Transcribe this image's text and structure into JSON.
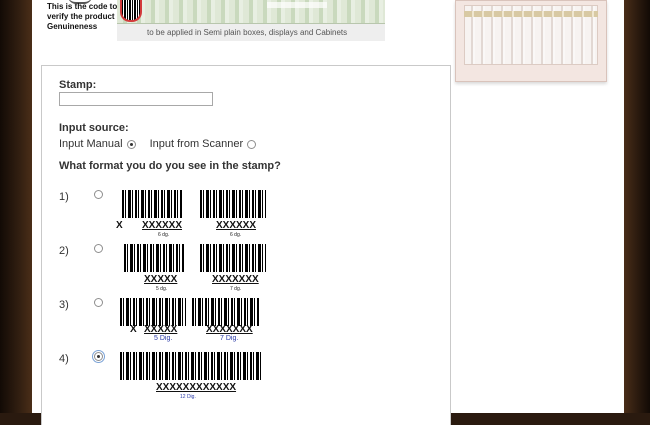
{
  "banner": {
    "code_note": "This is the code to verify the product Genuineness",
    "caption": "to be applied in Semi plain boxes, displays and Cabinets"
  },
  "form": {
    "stamp_label": "Stamp:",
    "stamp_value": "",
    "input_source_label": "Input source:",
    "input_manual_label": "Input Manual",
    "input_scanner_label": "Input from Scanner",
    "input_source_selected": "manual",
    "format_question": "What format you do you see in the stamp?",
    "selected_format": 4,
    "options": [
      {
        "number": "1)",
        "left_prefix": "X",
        "left_code": "XXXXXX",
        "left_digits": "6 dg.",
        "right_code": "XXXXXX",
        "right_digits": "6 dg."
      },
      {
        "number": "2)",
        "left_code": "XXXXX",
        "left_digits": "5 dg.",
        "right_code": "XXXXXXX",
        "right_digits": "7 dg."
      },
      {
        "number": "3)",
        "left_prefix": "X",
        "left_code": "XXXXX",
        "left_digits": "5 Dig.",
        "right_code": "XXXXXXX",
        "right_digits": "7 Dig."
      },
      {
        "number": "4)",
        "code": "XXXXXXXXXXXX",
        "digits": "12 Dig."
      }
    ]
  },
  "colors": {
    "frame": "#2f1d10",
    "panel_border": "#c9c9c9",
    "digit_blue": "#2a3aa8",
    "stamp_red": "#d23b3b"
  }
}
